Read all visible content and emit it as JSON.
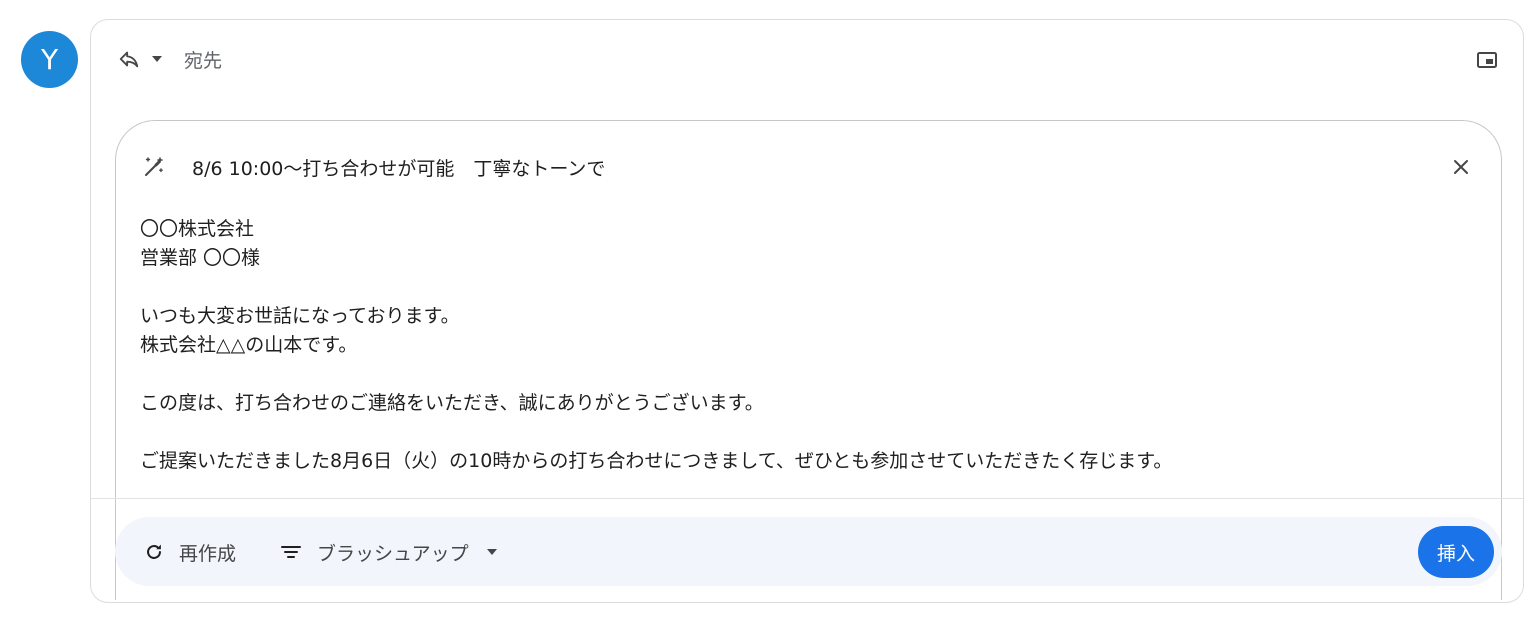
{
  "avatar": {
    "initial": "Y",
    "color": "#1e88d8"
  },
  "header": {
    "to_label": "宛先",
    "icons": {
      "reply": "reply-icon",
      "reply_menu": "chevron-down-icon",
      "popout": "popout-icon"
    }
  },
  "ai_panel": {
    "prompt": "8/6 10:00〜打ち合わせが可能　丁寧なトーンで",
    "icons": {
      "prompt": "magic-wand-icon",
      "close": "close-icon"
    },
    "draft_lines": [
      "〇〇株式会社",
      "営業部 〇〇様",
      "",
      "いつも大変お世話になっております。",
      "株式会社△△の山本です。",
      "",
      "この度は、打ち合わせのご連絡をいただき、誠にありがとうございます。",
      "",
      "ご提案いただきました8月6日（火）の10時からの打ち合わせにつきまして、ぜひとも参加させていただきたく存じます。"
    ]
  },
  "toolbar": {
    "regenerate_label": "再作成",
    "refine_label": "ブラッシュアップ",
    "insert_label": "挿入",
    "accent_color": "#1a73e8"
  }
}
